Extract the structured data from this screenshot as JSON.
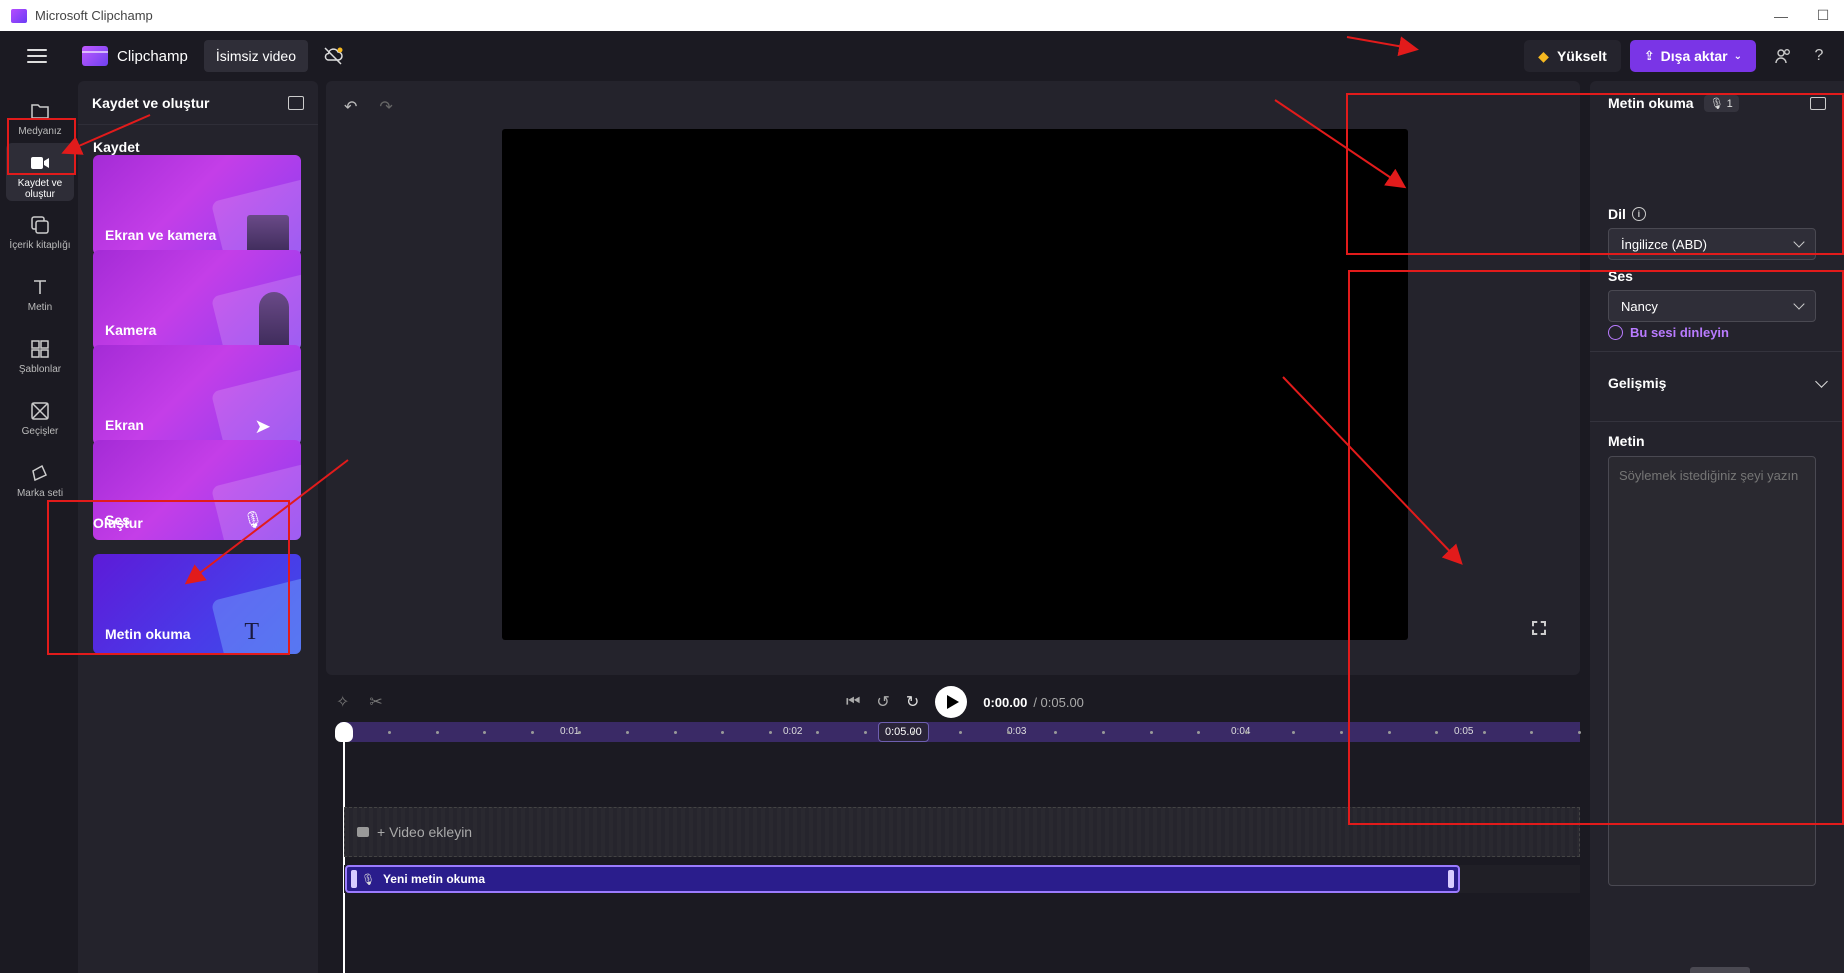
{
  "window": {
    "title": "Microsoft Clipchamp",
    "controls": [
      "—",
      "☐"
    ]
  },
  "header": {
    "brand": "Clipchamp",
    "project_title": "İsimsiz video",
    "upgrade_label": "Yükselt",
    "export_label": "Dışa aktar",
    "help_label": "?"
  },
  "rail": {
    "items": [
      {
        "label": "Medyanız",
        "icon": "folder-icon"
      },
      {
        "label": "Kaydet ve oluştur",
        "icon": "video-camera-icon"
      },
      {
        "label": "İçerik kitaplığı",
        "icon": "content-library-icon"
      },
      {
        "label": "Metin",
        "icon": "text-icon"
      },
      {
        "label": "Şablonlar",
        "icon": "templates-icon"
      },
      {
        "label": "Geçişler",
        "icon": "transitions-icon"
      },
      {
        "label": "Marka seti",
        "icon": "brand-kit-icon"
      }
    ]
  },
  "left_panel": {
    "title": "Kaydet ve oluştur",
    "record_section": "Kaydet",
    "create_section": "Oluştur",
    "cards": [
      {
        "label": "Ekran ve kamera"
      },
      {
        "label": "Kamera"
      },
      {
        "label": "Ekran"
      },
      {
        "label": "Ses"
      }
    ],
    "create_cards": [
      {
        "label": "Metin okuma"
      }
    ]
  },
  "playback": {
    "current_time": "0:00.00",
    "total_time": "/ 0:05.00",
    "skip_label": "5"
  },
  "timeline": {
    "ruler_labels": [
      "0:01",
      "0:02",
      "0:03",
      "0:04",
      "0:05"
    ],
    "marker_label": "0:05.00",
    "video_track_label": "+ Video ekleyin",
    "tts_clip_label": "Yeni metin okuma"
  },
  "right_panel": {
    "title": "Metin okuma",
    "badge": "1",
    "language_label": "Dil",
    "language_value": "İngilizce (ABD)",
    "voice_label": "Ses",
    "voice_value": "Nancy",
    "listen_label": "Bu sesi dinleyin",
    "advanced_label": "Gelişmiş",
    "text_label": "Metin",
    "text_placeholder": "Söylemek istediğiniz şeyi yazın"
  },
  "colors": {
    "accent": "#7a35e6",
    "annotation": "#e21b1b",
    "clip": "#2a1d8c"
  }
}
